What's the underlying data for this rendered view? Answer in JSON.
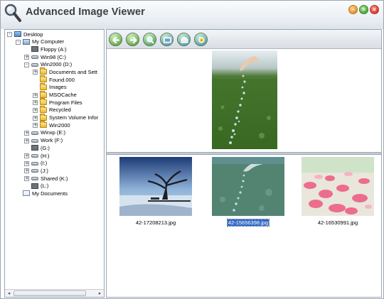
{
  "window": {
    "title": "Advanced Image Viewer"
  },
  "title_buttons": {
    "minimize": "–",
    "maximize": "=",
    "close": "×"
  },
  "tree": [
    {
      "label": "Desktop",
      "icon": "desktop-icon",
      "level": 0,
      "expander": "-"
    },
    {
      "label": "My Computer",
      "icon": "computer-icon",
      "level": 1,
      "expander": "-"
    },
    {
      "label": "Floppy (A:)",
      "icon": "floppy-icon",
      "level": 2,
      "expander": ""
    },
    {
      "label": "Win98 (C:)",
      "icon": "drive-icon",
      "level": 2,
      "expander": "+"
    },
    {
      "label": "Win2000 (D:)",
      "icon": "drive-icon",
      "level": 2,
      "expander": "-"
    },
    {
      "label": "Documents and Sett",
      "icon": "folder-icon",
      "level": 3,
      "expander": "+"
    },
    {
      "label": "Found.000",
      "icon": "folder-icon",
      "level": 3,
      "expander": ""
    },
    {
      "label": "Images",
      "icon": "folder-icon",
      "level": 3,
      "expander": ""
    },
    {
      "label": "MSOCache",
      "icon": "folder-icon",
      "level": 3,
      "expander": "+"
    },
    {
      "label": "Program Files",
      "icon": "folder-icon",
      "level": 3,
      "expander": "+"
    },
    {
      "label": "Recycled",
      "icon": "folder-icon",
      "level": 3,
      "expander": "+"
    },
    {
      "label": "System Volume Infor",
      "icon": "folder-icon",
      "level": 3,
      "expander": "+"
    },
    {
      "label": "Win2000",
      "icon": "folder-icon",
      "level": 3,
      "expander": "+"
    },
    {
      "label": "Winxp (E:)",
      "icon": "drive-icon",
      "level": 2,
      "expander": "+"
    },
    {
      "label": "Work (F:)",
      "icon": "drive-icon",
      "level": 2,
      "expander": "+"
    },
    {
      "label": "(G:)",
      "icon": "floppy-icon",
      "level": 2,
      "expander": ""
    },
    {
      "label": "(H:)",
      "icon": "drive-icon",
      "level": 2,
      "expander": "+"
    },
    {
      "label": "(I:)",
      "icon": "drive-icon",
      "level": 2,
      "expander": "+"
    },
    {
      "label": "(J:)",
      "icon": "drive-icon",
      "level": 2,
      "expander": "+"
    },
    {
      "label": "Shared (K:)",
      "icon": "drive-icon",
      "level": 2,
      "expander": "+"
    },
    {
      "label": "(L:)",
      "icon": "floppy-icon",
      "level": 2,
      "expander": ""
    },
    {
      "label": "My Documents",
      "icon": "docs-icon",
      "level": 1,
      "expander": ""
    }
  ],
  "toolbar": {
    "buttons": [
      {
        "name": "back-button",
        "icon": "arrow-left-icon"
      },
      {
        "name": "forward-button",
        "icon": "arrow-right-icon"
      },
      {
        "name": "zoom-button",
        "icon": "zoom-icon"
      },
      {
        "name": "slideshow-button",
        "icon": "slideshow-icon"
      },
      {
        "name": "print-button",
        "icon": "print-icon"
      },
      {
        "name": "settings-button",
        "icon": "settings-icon"
      }
    ]
  },
  "thumbnails": [
    {
      "filename": "42-17208213.jpg",
      "selected": false
    },
    {
      "filename": "42-15656398.jpg",
      "selected": true
    },
    {
      "filename": "42-16530991.jpg",
      "selected": false
    }
  ],
  "scrollbar": {
    "left_arrow": "◂",
    "right_arrow": "▸"
  },
  "colors": {
    "selection": "#316ac5",
    "toolbar_button": "#7fbf5a"
  }
}
